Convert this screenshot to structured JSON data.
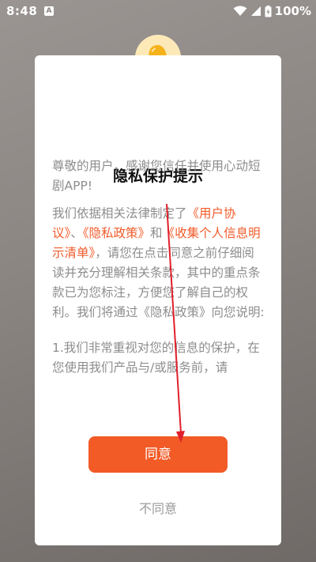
{
  "status_bar": {
    "time": "8:48",
    "app_icon_letter": "A",
    "battery_text": "100%"
  },
  "dialog": {
    "title": "隐私保护提示",
    "para1": "尊敬的用户，感谢您信任并使用心动短剧APP!",
    "para2_before": "我们依据相关法律制定了",
    "link_user_agreement": "《用户协议》",
    "sep1": "、",
    "link_privacy_policy": "《隐私政策》",
    "and": "和",
    "link_info_list": "《收集个人信息明示清单》",
    "para2_after": "，请您在点击同意之前仔细阅读并充分理解相关条款，其中的重点条款已为您标注，方便您了解自己的权利。我们将通过《隐私政策》向您说明:",
    "para3": "1.我们非常重视对您的信息的保护，在您使用我们产品与/或服务前，请",
    "agree_label": "同意",
    "disagree_label": "不同意"
  },
  "colors": {
    "accent": "#f25a26",
    "link": "#f15b2a",
    "bell": "#f6b21b",
    "annotation": "#e0202a"
  }
}
